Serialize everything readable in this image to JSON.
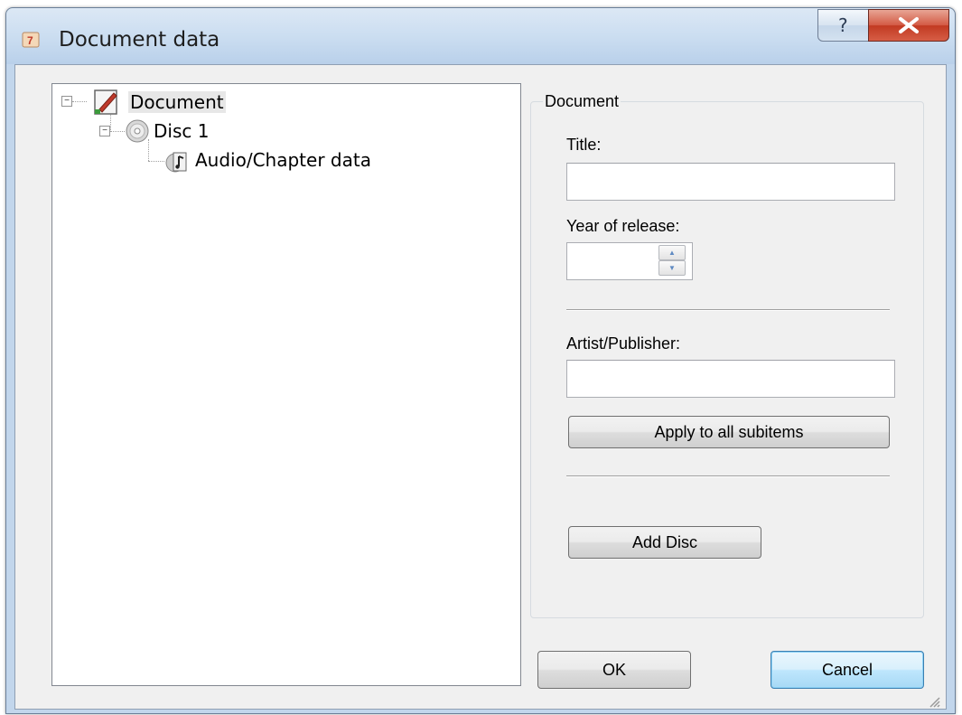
{
  "window": {
    "title": "Document data",
    "help_label": "?",
    "close_label": "X"
  },
  "tree": {
    "items": [
      {
        "label": "Document",
        "icon": "document-icon",
        "expanded": true
      },
      {
        "label": "Disc 1",
        "icon": "disc-icon",
        "expanded": true
      },
      {
        "label": "Audio/Chapter data",
        "icon": "audio-file-icon"
      }
    ]
  },
  "panel": {
    "group_title": "Document",
    "title_label": "Title:",
    "title_value": "",
    "year_label": "Year of release:",
    "year_value": "",
    "artist_label": "Artist/Publisher:",
    "artist_value": "",
    "apply_label": "Apply to all subitems",
    "add_disc_label": "Add Disc"
  },
  "footer": {
    "ok_label": "OK",
    "cancel_label": "Cancel"
  }
}
